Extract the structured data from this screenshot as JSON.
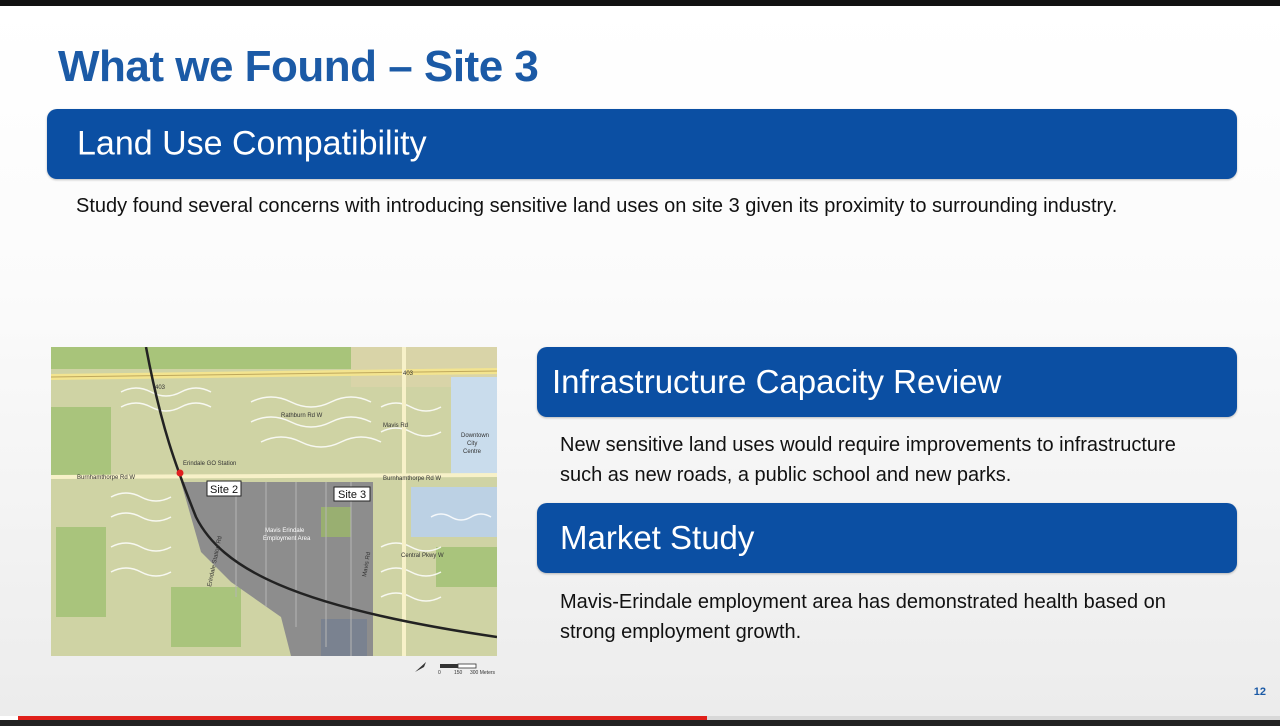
{
  "slide": {
    "title": "What we Found – Site 3",
    "page_number": "12",
    "sections": [
      {
        "heading": "Land Use Compatibility",
        "body": "Study found several concerns with introducing sensitive land uses on site 3 given its proximity to surrounding industry."
      },
      {
        "heading": "Infrastructure Capacity Review",
        "body": "New sensitive land uses would require improvements to infrastructure such as new roads, a public school and new parks."
      },
      {
        "heading": "Market Study",
        "body": "Mavis-Erindale employment area has demonstrated health based on strong employment growth."
      }
    ]
  },
  "map": {
    "labels": {
      "hwy_left": "403",
      "hwy_right": "403",
      "rathburn": "Rathburn Rd W",
      "mavis": "Mavis Rd",
      "downtown": [
        "Downtown",
        "City",
        "Centre"
      ],
      "station": "Erindale GO Station",
      "burnhamthorpe_left": "Burnhamthorpe Rd W",
      "burnhamthorpe_right": "Burnhamthorpe Rd W",
      "site2": "Site 2",
      "site3": "Site 3",
      "employment": [
        "Mavis Erindale",
        "Employment Area"
      ],
      "central_pkwy": "Central Pkwy W",
      "erindale_station_rd": "Erindale Station Rd",
      "mavis_south": "Mavis Rd",
      "central_pkwy_w2": "Central Pkwy W",
      "scale_0": "0",
      "scale_150": "150",
      "scale_300": "300 Meters"
    }
  },
  "video": {
    "progress": 0.546
  },
  "colors": {
    "title": "#1b5aa6",
    "band": "#0b4fa3",
    "progress": "#e0201a"
  }
}
